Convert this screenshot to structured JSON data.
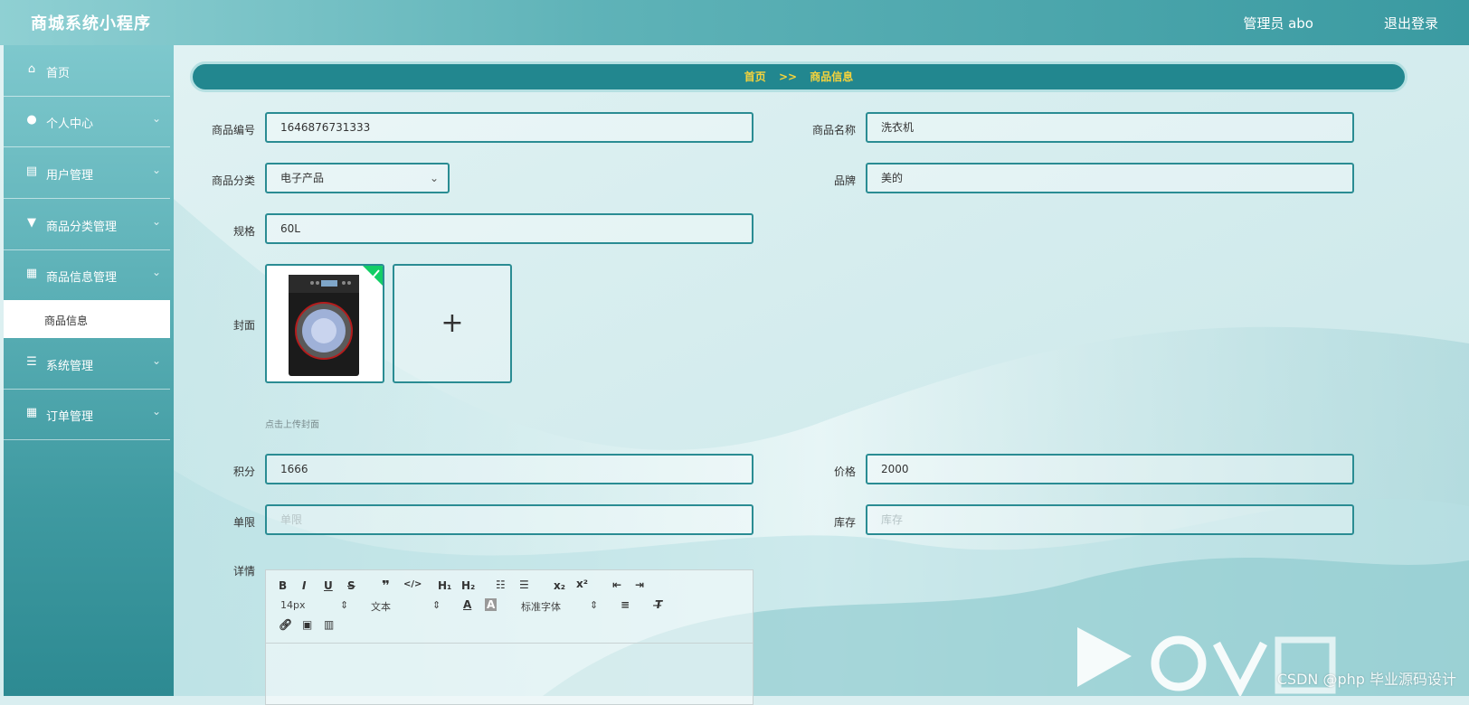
{
  "app": {
    "title": "商城系统小程序",
    "admin_label": "管理员 abo",
    "logout_label": "退出登录"
  },
  "sidebar": {
    "items": [
      {
        "label": "首页",
        "icon": "home-icon"
      },
      {
        "label": "个人中心",
        "icon": "user-icon"
      },
      {
        "label": "用户管理",
        "icon": "clipboard-icon"
      },
      {
        "label": "商品分类管理",
        "icon": "category-icon"
      },
      {
        "label": "商品信息管理",
        "icon": "grid-icon"
      },
      {
        "label": "系统管理",
        "icon": "list-icon"
      },
      {
        "label": "订单管理",
        "icon": "grid-icon"
      }
    ],
    "submenu": {
      "label": "商品信息"
    }
  },
  "breadcrumb": {
    "home": "首页",
    "separator": ">>",
    "current": "商品信息"
  },
  "form": {
    "product_code": {
      "label": "商品编号",
      "value": "1646876731333"
    },
    "product_name": {
      "label": "商品名称",
      "value": "洗衣机"
    },
    "category": {
      "label": "商品分类",
      "value": "电子产品"
    },
    "brand": {
      "label": "品牌",
      "value": "美的"
    },
    "spec": {
      "label": "规格",
      "value": "60L"
    },
    "cover": {
      "label": "封面",
      "hint": "点击上传封面"
    },
    "points": {
      "label": "积分",
      "value": "1666"
    },
    "price": {
      "label": "价格",
      "value": "2000"
    },
    "limit": {
      "label": "单限",
      "placeholder": "单限"
    },
    "stock": {
      "label": "库存",
      "placeholder": "库存"
    },
    "detail": {
      "label": "详情"
    }
  },
  "editor": {
    "font_size": "14px",
    "text_type": "文本",
    "font_family": "标准字体"
  },
  "watermark": {
    "csdn": "CSDN @php 毕业源码设计"
  },
  "colors": {
    "accent": "#22878f",
    "breadcrumb_text": "#f5d33c",
    "border": "#2a8c93"
  }
}
